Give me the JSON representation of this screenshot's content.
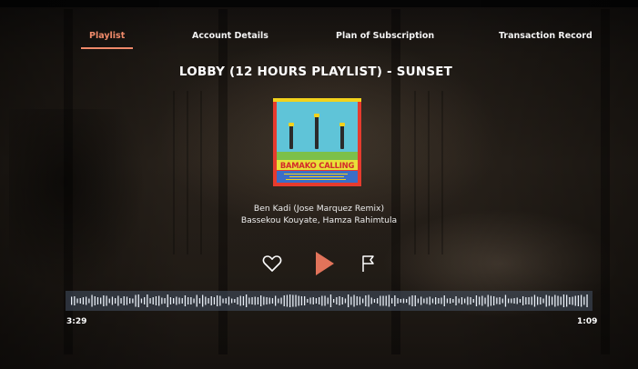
{
  "nav": {
    "tabs": [
      {
        "label": "Playlist",
        "active": true
      },
      {
        "label": "Account Details",
        "active": false
      },
      {
        "label": "Plan of Subscription",
        "active": false
      },
      {
        "label": "Transaction Record",
        "active": false
      }
    ]
  },
  "playlist_title": "LOBBY (12 HOURS PLAYLIST) - SUNSET",
  "album_art": {
    "text": "BAMAKO CALLING"
  },
  "now_playing": {
    "track": "Ben Kadi (Jose Marquez Remix)",
    "artist": "Bassekou Kouyate, Hamza Rahimtula"
  },
  "controls": {
    "like_icon": "heart-icon",
    "play_icon": "play-icon",
    "report_icon": "flag-icon"
  },
  "progress": {
    "elapsed": "3:29",
    "remaining": "1:09"
  },
  "colors": {
    "accent": "#f08a6a",
    "play": "#e1735a"
  }
}
